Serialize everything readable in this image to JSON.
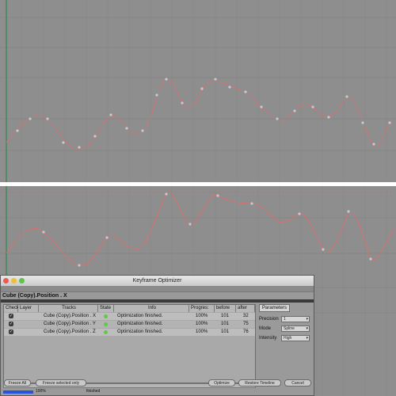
{
  "dialog": {
    "title": "Keyframe Optimizer",
    "track_name": "Cube (Copy).Position . X",
    "columns": [
      "Check",
      "Layer",
      "Tracks",
      "State",
      "Info",
      "Progres:",
      "before",
      "after"
    ],
    "rows": [
      {
        "track": "Cube (Copy).Position . X",
        "info": "Optimization finished.",
        "progress": "100%",
        "before": "101",
        "after": "32",
        "checked": true
      },
      {
        "track": "Cube (Copy).Position . Y",
        "info": "Optimization finished.",
        "progress": "100%",
        "before": "101",
        "after": "75",
        "checked": true
      },
      {
        "track": "Cube (Copy).Position . Z",
        "info": "Optimization finished.",
        "progress": "100%",
        "before": "101",
        "after": "76",
        "checked": true
      }
    ],
    "parameters_tab": "Parameters",
    "precision_label": "Precision",
    "precision_value": "1",
    "mode_label": "Mode",
    "mode_value": "Spline",
    "intensity_label": "Intensity",
    "intensity_value": "High",
    "buttons": {
      "freeze_all": "Freeze All",
      "freeze_selected": "Freeze selected only",
      "optimize": "Optimize",
      "restore": "Restore Timeline",
      "cancel": "Cancel"
    },
    "status": {
      "progress": "100%",
      "text": "finished",
      "progress_fraction": 1.0
    }
  },
  "colors": {
    "background": "#8e8e8e",
    "curve": "#d9706f",
    "keyframe": "#c9c9d6",
    "accent": "#2754d9"
  }
}
